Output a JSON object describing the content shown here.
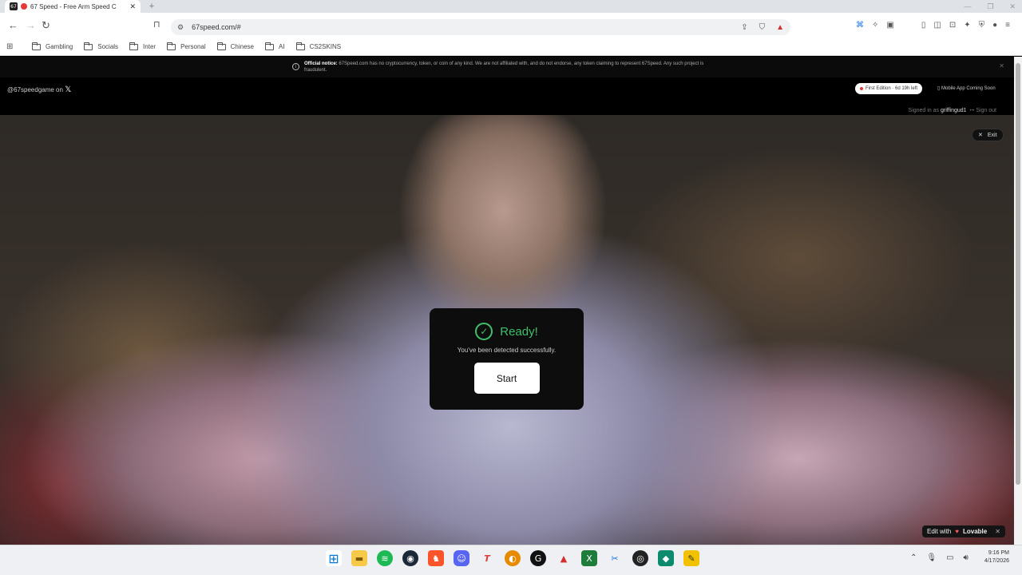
{
  "browser": {
    "tab_title": "67 Speed - Free Arm Speed C",
    "tab_favicon": "67",
    "url": "67speed.com/#"
  },
  "bookmarks": [
    "Gambling",
    "Socials",
    "Inter",
    "Personal",
    "Chinese",
    "AI",
    "CS2SKINS"
  ],
  "page": {
    "notice_label": "Official notice:",
    "notice_text": "67Speed.com has no cryptocurrency, token, or coin of any kind. We are not affiliated with, and do not endorse, any token claiming to represent 67Speed. Any such project is fraudulent.",
    "social_handle": "@67speedgame on",
    "edition_badge": "First Edition · 6d 19h left",
    "mobile_text": "Mobile App Coming Soon",
    "signed_in_prefix": "Signed in as",
    "username": "griffingud1",
    "sign_out": "Sign out",
    "exit_label": "Exit",
    "ready_title": "Ready!",
    "ready_subtitle": "You've been detected successfully.",
    "start_label": "Start",
    "edit_with": "Edit with",
    "lovable": "Lovable"
  },
  "taskbar": {
    "time": "9:16 PM",
    "date": "4/17/2026"
  },
  "colors": {
    "accent_green": "#3fbf6a",
    "recording_red": "#e53935"
  }
}
